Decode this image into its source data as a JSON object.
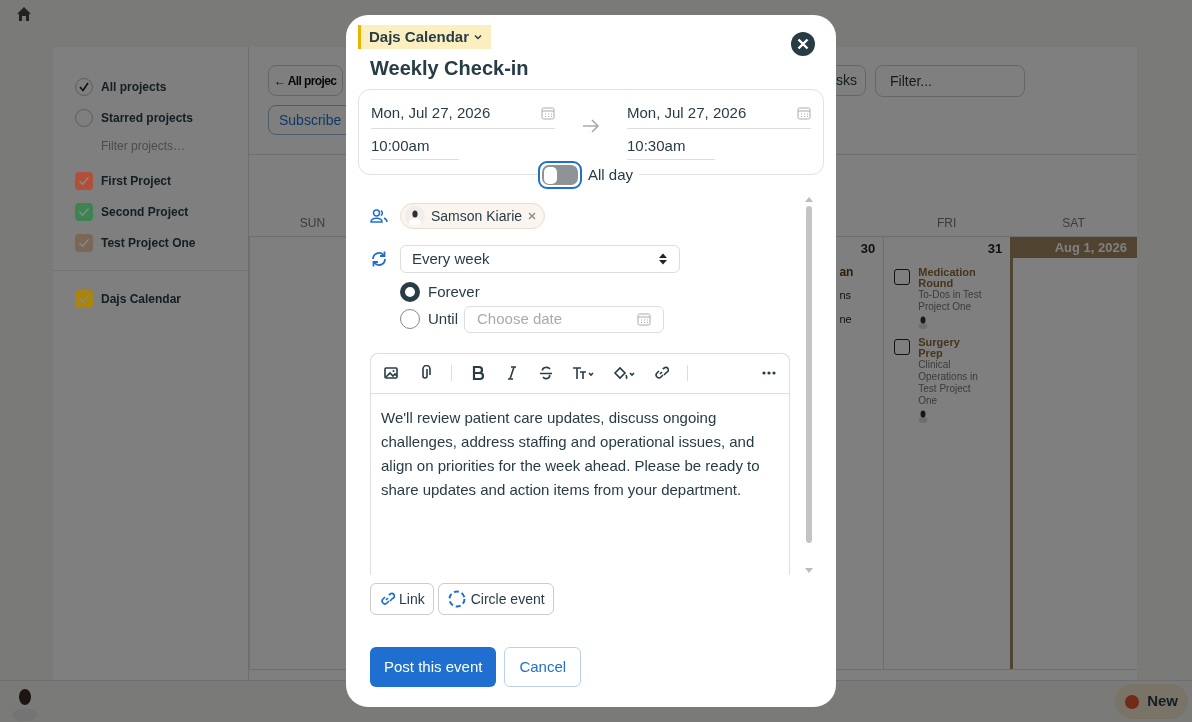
{
  "sidebar": {
    "filters": [
      {
        "label": "All projects",
        "checked": true
      },
      {
        "label": "Starred projects",
        "checked": false
      }
    ],
    "filter_placeholder": "Filter projects…",
    "projects": [
      {
        "label": "First Project",
        "color": "#b0503a",
        "checked": true
      },
      {
        "label": "Second Project",
        "color": "#3e8450",
        "checked": true
      },
      {
        "label": "Test Project One",
        "color": "#786855",
        "checked": true
      }
    ],
    "calendars": [
      {
        "label": "Dajs Calendar",
        "color": "#a8850f",
        "checked": true
      }
    ]
  },
  "toolbar": {
    "back": "← All projec",
    "subscribe": "Subscribe",
    "tasks": "sks",
    "filter_placeholder": "Filter..."
  },
  "calendar": {
    "columns": [
      {
        "name": "SUN"
      },
      {},
      {},
      {},
      {
        "date": "30",
        "fragments": [
          "an",
          "ns",
          "ne"
        ]
      },
      {
        "name": "FRI",
        "date": "31",
        "events": [
          {
            "title": "Medication Round",
            "subtitle": "To-Dos in Test Project One",
            "checked": false
          },
          {
            "title": "Surgery Prep",
            "subtitle": "Clinical Operations in Test Project One",
            "checked": false
          }
        ]
      },
      {
        "name": "SAT",
        "date": "Aug 1, 2026",
        "today": true
      }
    ]
  },
  "new_button": "New",
  "modal": {
    "calendar": "Dajs Calendar",
    "title": "Weekly Check-in",
    "start": {
      "date": "Mon, Jul 27, 2026",
      "time": "10:00am"
    },
    "end": {
      "date": "Mon, Jul 27, 2026",
      "time": "10:30am"
    },
    "all_day": {
      "label": "All day",
      "on": false
    },
    "attendees": [
      {
        "name": "Samson Kiarie"
      }
    ],
    "repeat": "Every week",
    "repeat_until": [
      {
        "label": "Forever",
        "selected": true
      },
      {
        "label": "Until",
        "selected": false
      }
    ],
    "until_placeholder": "Choose date",
    "notes": "We'll review patient care updates, discuss ongoing challenges, address staffing and operational issues, and align on priorities for the week ahead. Please be ready to share updates and action items from your department.",
    "attachments": [
      {
        "kind": "link",
        "label": "Link"
      },
      {
        "kind": "circle",
        "label": "Circle event"
      }
    ],
    "post": "Post this event",
    "cancel": "Cancel"
  }
}
